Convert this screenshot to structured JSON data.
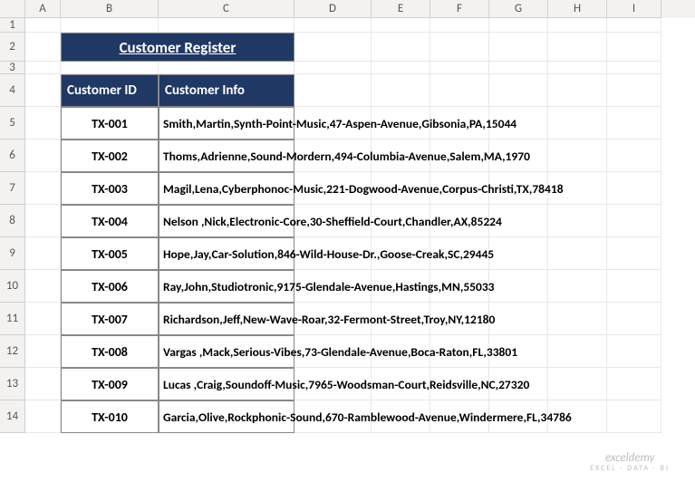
{
  "columns": [
    "A",
    "B",
    "C",
    "D",
    "E",
    "F",
    "G",
    "H",
    "I"
  ],
  "row_numbers": [
    1,
    2,
    3,
    4,
    5,
    6,
    7,
    8,
    9,
    10,
    11,
    12,
    13,
    14
  ],
  "title": "Customer Register",
  "headers": {
    "id": "Customer ID",
    "info": "Customer Info"
  },
  "rows": [
    {
      "id": "TX-001",
      "info": "Smith,Martin,Synth-Point-Music,47-Aspen-Avenue,Gibsonia,PA,15044"
    },
    {
      "id": "TX-002",
      "info": "Thoms,Adrienne,Sound-Mordern,494-Columbia-Avenue,Salem,MA,1970"
    },
    {
      "id": "TX-003",
      "info": "Magil,Lena,Cyberphonoc-Music,221-Dogwood-Avenue,Corpus-Christi,TX,78418"
    },
    {
      "id": "TX-004",
      "info": "Nelson ,Nick,Electronic-Core,30-Sheffield-Court,Chandler,AX,85224"
    },
    {
      "id": "TX-005",
      "info": "Hope,Jay,Car-Solution,846-Wild-House-Dr.,Goose-Creak,SC,29445"
    },
    {
      "id": "TX-006",
      "info": "Ray,John,Studiotronic,9175-Glendale-Avenue,Hastings,MN,55033"
    },
    {
      "id": "TX-007",
      "info": "Richardson,Jeff,New-Wave-Roar,32-Fermont-Street,Troy,NY,12180"
    },
    {
      "id": "TX-008",
      "info": "Vargas ,Mack,Serious-Vibes,73-Glendale-Avenue,Boca-Raton,FL,33801"
    },
    {
      "id": "TX-009",
      "info": "Lucas ,Craig,Soundoff-Music,7965-Woodsman-Court,Reidsville,NC,27320"
    },
    {
      "id": "TX-010",
      "info": "Garcia,Olive,Rockphonic-Sound,670-Ramblewood-Avenue,Windermere,FL,34786"
    }
  ],
  "watermark": {
    "line1": "exceldemy",
    "line2": "EXCEL · DATA · BI"
  }
}
